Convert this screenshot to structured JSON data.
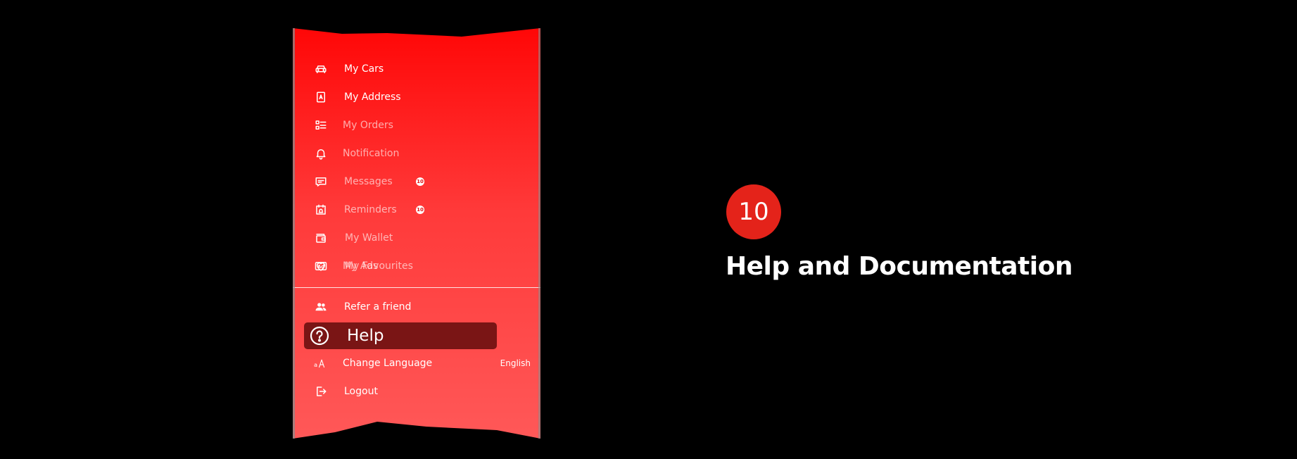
{
  "drawer": {
    "menu_items": [
      {
        "label": "My Cars",
        "icon": "car-icon"
      },
      {
        "label": "My Address",
        "icon": "address-book-icon"
      },
      {
        "label": "My Orders",
        "icon": "list-icon"
      },
      {
        "label": "Notification",
        "icon": "bell-icon"
      },
      {
        "label": "Messages",
        "icon": "chat-icon",
        "badge": "10"
      },
      {
        "label": "Reminders",
        "icon": "calendar-bell-icon",
        "badge": "10"
      },
      {
        "label": "My Wallet",
        "icon": "wallet-icon"
      },
      {
        "label": "My Ads",
        "icon": "ad-icon"
      },
      {
        "label": "My Favourites",
        "icon": "heart-icon"
      }
    ],
    "secondary_items": [
      {
        "label": "Refer a friend",
        "icon": "users-icon"
      },
      {
        "label": "Help",
        "icon": "help-circle-icon",
        "selected": true
      },
      {
        "label": "Change Language",
        "icon": "font-size-icon",
        "value": "English"
      },
      {
        "label": "Logout",
        "icon": "logout-icon"
      }
    ]
  },
  "step": {
    "number": "10",
    "title": "Help and Documentation"
  },
  "colors": {
    "drawer_top": "#ff0707",
    "drawer_bottom": "#ff5858",
    "selected_bg": "#7a1515",
    "step_badge": "#e4231a"
  }
}
